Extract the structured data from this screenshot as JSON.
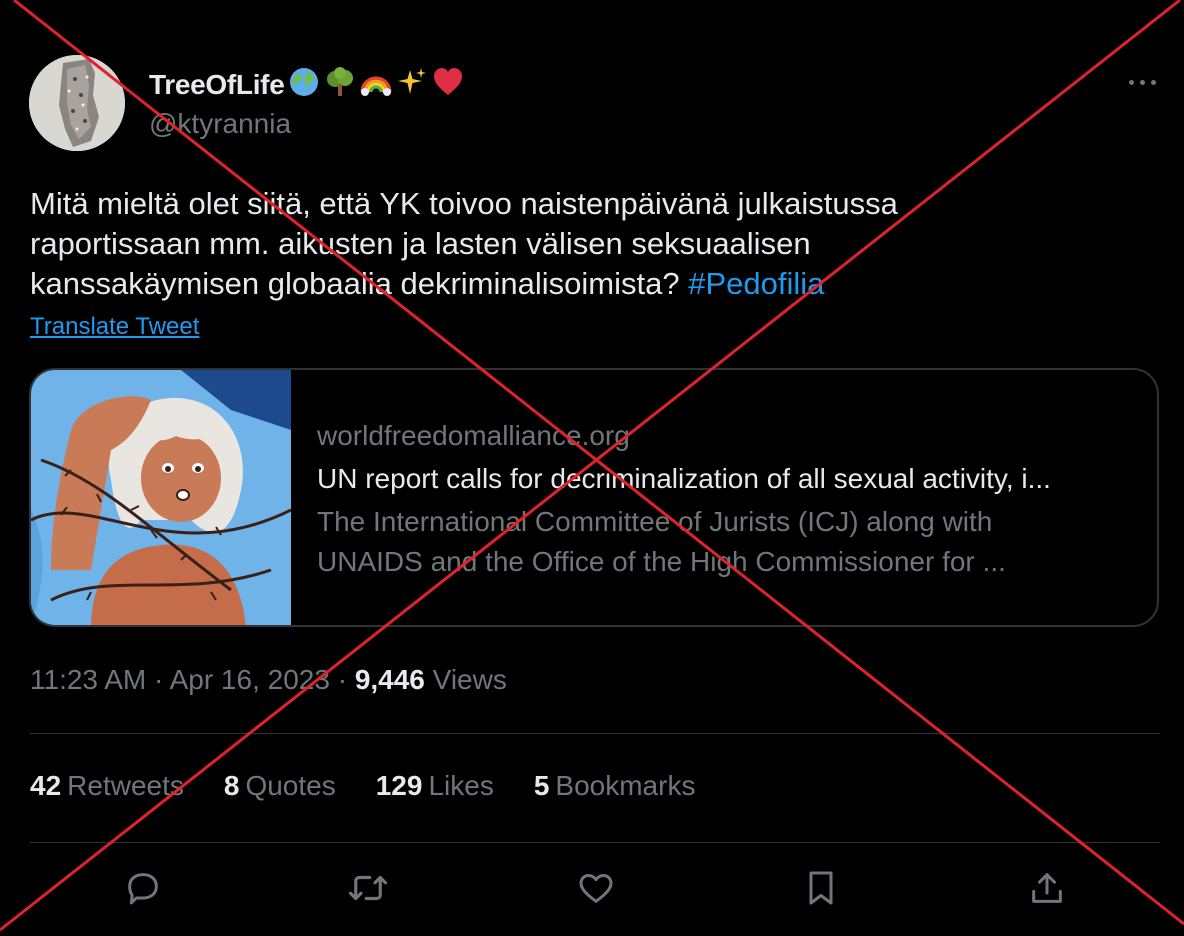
{
  "author": {
    "display_name": "TreeOfLife",
    "name_emojis": [
      "globe-icon",
      "tree-icon",
      "rainbow-icon",
      "sparkles-icon",
      "heart-icon"
    ],
    "handle": "@ktyrannia"
  },
  "tweet": {
    "text_lines": [
      "Mitä mieltä olet siitä, että YK toivoo naistenpäivänä julkaistussa",
      "raportissaan mm. aikusten ja lasten välisen seksuaalisen",
      "kanssakäymisen globaalia dekriminalisoimista? "
    ],
    "hashtag": "#Pedofilia",
    "translate_label": "Translate Tweet"
  },
  "card": {
    "domain": "worldfreedomalliance.org",
    "title": "UN report calls for decriminalization of all sexual activity, i...",
    "description_lines": [
      "The International Committee of Jurists (ICJ) along with",
      "UNAIDS and the Office of the High Commissioner for ..."
    ]
  },
  "meta": {
    "time": "11:23 AM",
    "separator": " · ",
    "date": "Apr 16, 2023",
    "views_count": "9,446",
    "views_label": " Views"
  },
  "stats": [
    {
      "count": "42",
      "label": "Retweets"
    },
    {
      "count": "8",
      "label": "Quotes"
    },
    {
      "count": "129",
      "label": "Likes"
    },
    {
      "count": "5",
      "label": "Bookmarks"
    }
  ],
  "actions": [
    "reply-icon",
    "retweet-icon",
    "like-icon",
    "bookmark-icon",
    "share-icon"
  ],
  "colors": {
    "background": "#000000",
    "text": "#e7e9ea",
    "secondary": "#71767b",
    "link": "#1d9bf0",
    "border": "#2f3336",
    "overlay_cross": "#e0222b"
  }
}
